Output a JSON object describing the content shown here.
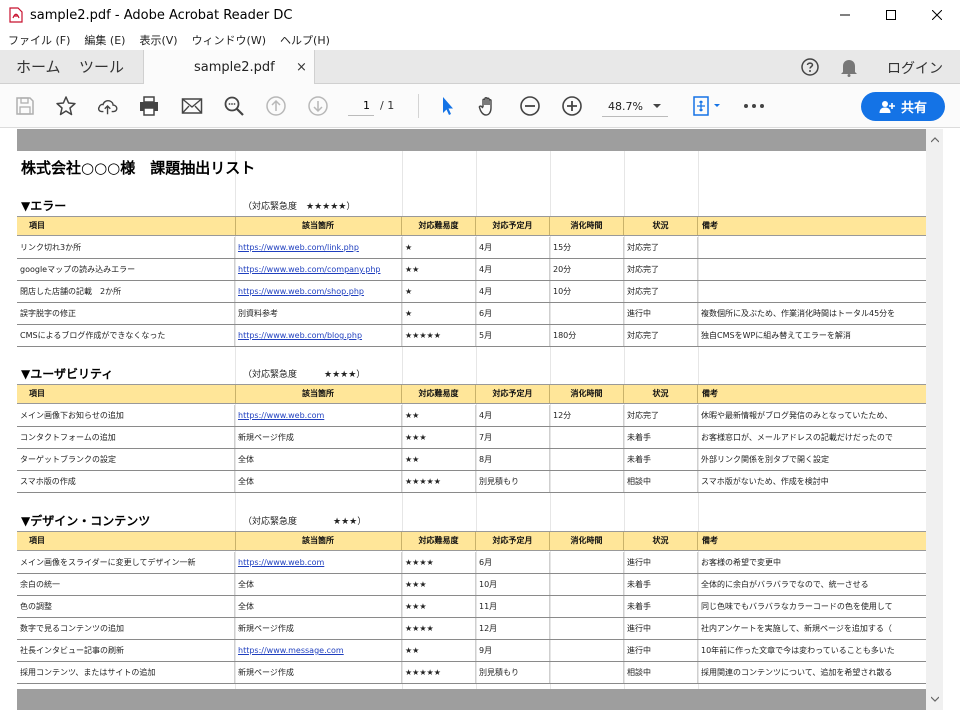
{
  "window": {
    "title": "sample2.pdf - Adobe Acrobat Reader DC"
  },
  "menu": [
    "ファイル (F)",
    "編集 (E)",
    "表示(V)",
    "ウィンドウ(W)",
    "ヘルプ(H)"
  ],
  "tabs": {
    "home": "ホーム",
    "tools": "ツール",
    "document": "sample2.pdf",
    "close": "×",
    "login": "ログイン"
  },
  "toolbar": {
    "page_current": "1",
    "page_total": "/  1",
    "zoom": "48.7%",
    "share_label": "共有",
    "accent_color": "#1473e6"
  },
  "document": {
    "title": "株式会社○○○様　課題抽出リスト",
    "columns": [
      "項目",
      "該当箇所",
      "対応難易度",
      "対応予定月",
      "消化時間",
      "状況",
      "備考"
    ],
    "header_color": "#ffe699",
    "sections": [
      {
        "heading": "▼エラー",
        "urgency": "（対応緊急度　★★★★★）",
        "rows": [
          [
            "リンク切れ3か所",
            "https://www.web.com/link.php",
            "★",
            "4月",
            "15分",
            "対応完了",
            ""
          ],
          [
            "googleマップの読み込みエラー",
            "https://www.web.com/company.php",
            "★★",
            "4月",
            "20分",
            "対応完了",
            ""
          ],
          [
            "閉店した店舗の記載　2か所",
            "https://www.web.com/shop.php",
            "★",
            "4月",
            "10分",
            "対応完了",
            ""
          ],
          [
            "誤字脱字の修正",
            "別資料参考",
            "★",
            "6月",
            "",
            "進行中",
            "複数個所に及ぶため、作業消化時間はトータル45分を"
          ],
          [
            "CMSによるブログ作成ができなくなった",
            "https://www.web.com/blog.php",
            "★★★★★",
            "5月",
            "180分",
            "対応完了",
            "独自CMSをWPに組み替えてエラーを解消"
          ]
        ]
      },
      {
        "heading": "▼ユーザビリティ",
        "urgency": "（対応緊急度　　　★★★★）",
        "rows": [
          [
            "メイン画像下お知らせの追加",
            "https://www.web.com",
            "★★",
            "4月",
            "12分",
            "対応完了",
            "休暇や最新情報がブログ発信のみとなっていたため、"
          ],
          [
            "コンタクトフォームの追加",
            "新規ページ作成",
            "★★★",
            "7月",
            "",
            "未着手",
            "お客様窓口が、メールアドレスの記載だけだったので"
          ],
          [
            "ターゲットブランクの設定",
            "全体",
            "★★",
            "8月",
            "",
            "未着手",
            "外部リンク関係を別タブで開く設定"
          ],
          [
            "スマホ版の作成",
            "全体",
            "★★★★★",
            "別見積もり",
            "",
            "相談中",
            "スマホ版がないため、作成を検討中"
          ]
        ]
      },
      {
        "heading": "▼デザイン・コンテンツ",
        "urgency": "（対応緊急度　　　　★★★）",
        "rows": [
          [
            "メイン画像をスライダーに変更してデザイン一新",
            "https://www.web.com",
            "★★★★",
            "6月",
            "",
            "進行中",
            "お客様の希望で変更中"
          ],
          [
            "余白の統一",
            "全体",
            "★★★",
            "10月",
            "",
            "未着手",
            "全体的に余白がバラバラでなので、統一させる"
          ],
          [
            "色の調整",
            "全体",
            "★★★",
            "11月",
            "",
            "未着手",
            "同じ色味でもバラバラなカラーコードの色を使用して"
          ],
          [
            "数字で見るコンテンツの追加",
            "新規ページ作成",
            "★★★★",
            "12月",
            "",
            "進行中",
            "社内アンケートを実施して、新規ページを追加する（"
          ],
          [
            "社長インタビュー記事の刷新",
            "https://www.message.com",
            "★★",
            "9月",
            "",
            "進行中",
            "10年前に作った文章で今は変わっていることも多いた"
          ],
          [
            "採用コンテンツ、またはサイトの追加",
            "新規ページ作成",
            "★★★★★",
            "別見積もり",
            "",
            "相談中",
            "採用関連のコンテンツについて、追加を希望され散る"
          ]
        ]
      }
    ]
  }
}
